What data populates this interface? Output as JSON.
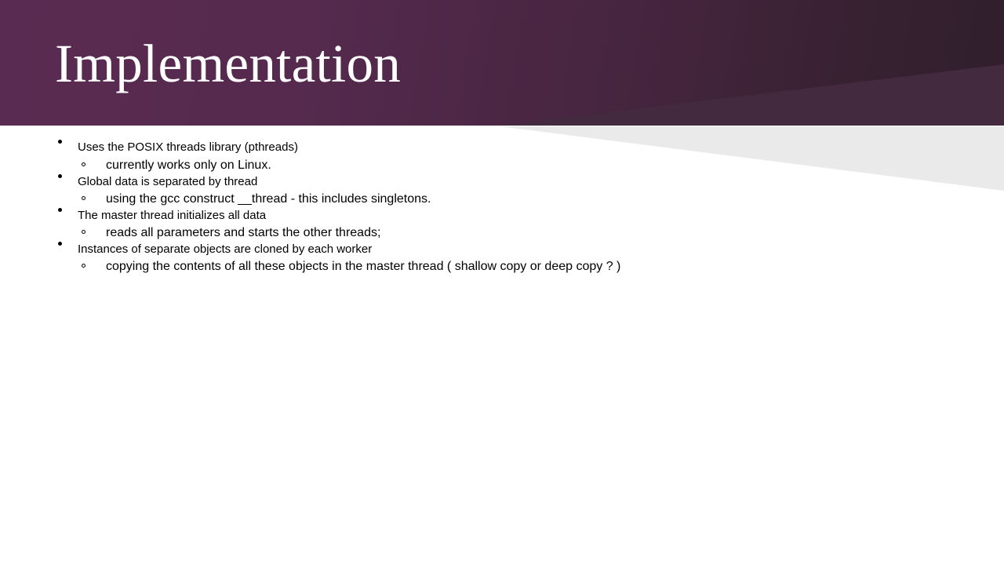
{
  "slide": {
    "title": "Implementation",
    "theme": {
      "header_left_color": "#5a2b52",
      "header_right_color": "#311e2c",
      "header_accent_color": "#432a3f",
      "wedge_color": "#eaeaea",
      "title_color": "#ffffff",
      "body_text_color": "#000000"
    },
    "bullets": [
      {
        "level": 1,
        "text": "Uses the POSIX threads library (pthreads)"
      },
      {
        "level": 2,
        "text": "currently works only on Linux."
      },
      {
        "level": 1,
        "text": "Global data is separated by thread"
      },
      {
        "level": 2,
        "text": "using the gcc construct __thread - this includes singletons."
      },
      {
        "level": 1,
        "text": "The master thread initializes all data"
      },
      {
        "level": 2,
        "text": "reads all parameters and starts the other threads;"
      },
      {
        "level": 1,
        "text": "Instances of separate objects are cloned by each worker"
      },
      {
        "level": 2,
        "text": "copying the contents of all these objects in the master thread ( shallow copy or deep copy ? )"
      }
    ]
  }
}
